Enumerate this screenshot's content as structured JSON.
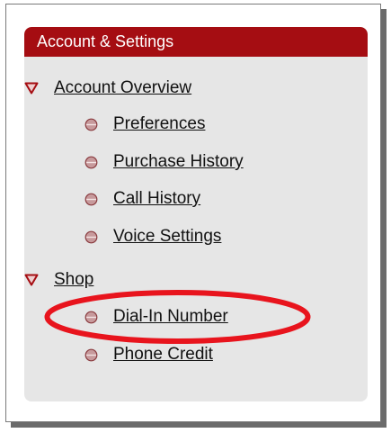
{
  "panel": {
    "title": "Account & Settings",
    "accent_color": "#a50d12",
    "callout_color": "#e8141d"
  },
  "nav": {
    "sections": [
      {
        "label": "Account Overview",
        "icon": "triangle-down-icon",
        "items": [
          {
            "label": "Preferences",
            "icon": "bullet-dot-icon"
          },
          {
            "label": "Purchase History",
            "icon": "bullet-dot-icon"
          },
          {
            "label": "Call History",
            "icon": "bullet-dot-icon"
          },
          {
            "label": "Voice Settings",
            "icon": "bullet-dot-icon"
          }
        ]
      },
      {
        "label": "Shop",
        "icon": "triangle-down-icon",
        "items": [
          {
            "label": "Dial-In Number",
            "icon": "bullet-dot-icon",
            "highlighted": true
          },
          {
            "label": "Phone Credit",
            "icon": "bullet-dot-icon"
          }
        ]
      }
    ]
  }
}
